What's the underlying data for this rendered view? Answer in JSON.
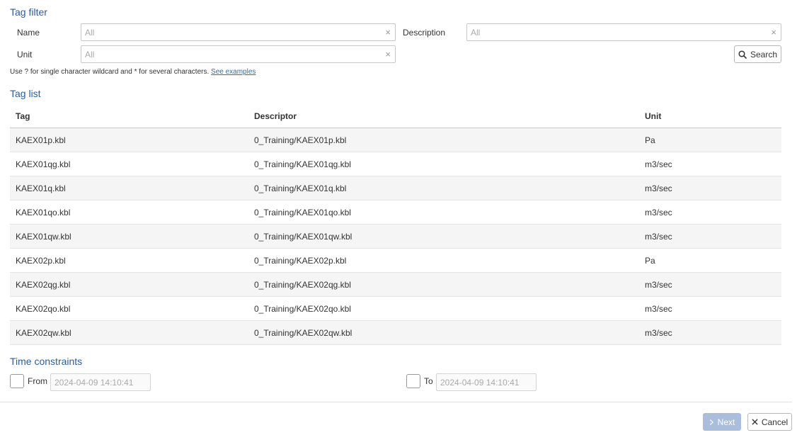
{
  "tag_filter": {
    "title": "Tag filter",
    "name_label": "Name",
    "name_placeholder": "All",
    "description_label": "Description",
    "description_placeholder": "All",
    "unit_label": "Unit",
    "unit_placeholder": "All",
    "clear_glyph": "×",
    "search_label": "Search",
    "hint_text": "Use ? for single character wildcard and * for several characters.",
    "hint_link": "See examples"
  },
  "tag_list": {
    "title": "Tag list",
    "columns": [
      "Tag",
      "Descriptor",
      "Unit"
    ],
    "rows": [
      [
        "KAEX01p.kbl",
        "0_Training/KAEX01p.kbl",
        "Pa"
      ],
      [
        "KAEX01qg.kbl",
        "0_Training/KAEX01qg.kbl",
        "m3/sec"
      ],
      [
        "KAEX01q.kbl",
        "0_Training/KAEX01q.kbl",
        "m3/sec"
      ],
      [
        "KAEX01qo.kbl",
        "0_Training/KAEX01qo.kbl",
        "m3/sec"
      ],
      [
        "KAEX01qw.kbl",
        "0_Training/KAEX01qw.kbl",
        "m3/sec"
      ],
      [
        "KAEX02p.kbl",
        "0_Training/KAEX02p.kbl",
        "Pa"
      ],
      [
        "KAEX02qg.kbl",
        "0_Training/KAEX02qg.kbl",
        "m3/sec"
      ],
      [
        "KAEX02qo.kbl",
        "0_Training/KAEX02qo.kbl",
        "m3/sec"
      ],
      [
        "KAEX02qw.kbl",
        "0_Training/KAEX02qw.kbl",
        "m3/sec"
      ]
    ]
  },
  "time_constraints": {
    "title": "Time constraints",
    "from_label": "From",
    "from_placeholder": "2024-04-09 14:10:41",
    "to_label": "To",
    "to_placeholder": "2024-04-09 14:10:41"
  },
  "footer": {
    "next_label": "Next",
    "cancel_label": "Cancel"
  },
  "colors": {
    "accent": "#2a5d9f",
    "link": "#2a6db5",
    "next_disabled_bg": "#a9bedc"
  },
  "icons": {
    "search": "magnifier-icon",
    "next": "chevron-right-icon",
    "cancel": "close-icon"
  }
}
